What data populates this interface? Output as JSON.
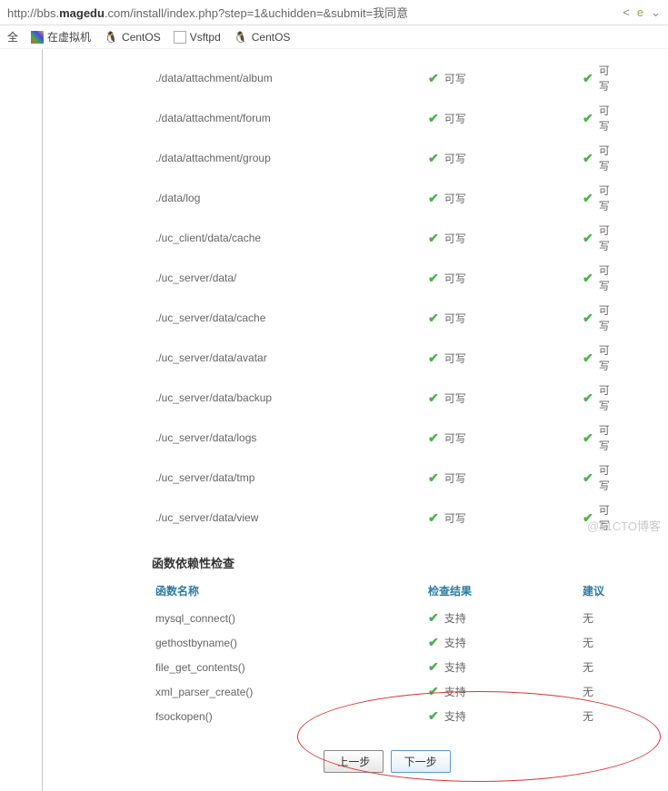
{
  "url": {
    "prefix": "http://bbs.",
    "domain": "magedu",
    "suffix": ".com/install/index.php?step=1&uchidden=&submit=我同意"
  },
  "bookmarks": {
    "b0": "全",
    "b1": "在虚拟机",
    "b2": "CentOS",
    "b3": "Vsftpd",
    "b4": "CentOS"
  },
  "paths": [
    {
      "path": "./data/attachment/album",
      "check": "可写",
      "rec": "可写"
    },
    {
      "path": "./data/attachment/forum",
      "check": "可写",
      "rec": "可写"
    },
    {
      "path": "./data/attachment/group",
      "check": "可写",
      "rec": "可写"
    },
    {
      "path": "./data/log",
      "check": "可写",
      "rec": "可写"
    },
    {
      "path": "./uc_client/data/cache",
      "check": "可写",
      "rec": "可写"
    },
    {
      "path": "./uc_server/data/",
      "check": "可写",
      "rec": "可写"
    },
    {
      "path": "./uc_server/data/cache",
      "check": "可写",
      "rec": "可写"
    },
    {
      "path": "./uc_server/data/avatar",
      "check": "可写",
      "rec": "可写"
    },
    {
      "path": "./uc_server/data/backup",
      "check": "可写",
      "rec": "可写"
    },
    {
      "path": "./uc_server/data/logs",
      "check": "可写",
      "rec": "可写"
    },
    {
      "path": "./uc_server/data/tmp",
      "check": "可写",
      "rec": "可写"
    },
    {
      "path": "./uc_server/data/view",
      "check": "可写",
      "rec": "可写"
    }
  ],
  "func_section_title": "函数依赖性检查",
  "func_headers": {
    "name": "函数名称",
    "result": "检查结果",
    "advice": "建议"
  },
  "funcs": [
    {
      "name": "mysql_connect()",
      "result": "支持",
      "advice": "无"
    },
    {
      "name": "gethostbyname()",
      "result": "支持",
      "advice": "无"
    },
    {
      "name": "file_get_contents()",
      "result": "支持",
      "advice": "无"
    },
    {
      "name": "xml_parser_create()",
      "result": "支持",
      "advice": "无"
    },
    {
      "name": "fsockopen()",
      "result": "支持",
      "advice": "无"
    }
  ],
  "buttons": {
    "prev": "上一步",
    "next": "下一步"
  },
  "watermark": "@51CTO博客"
}
